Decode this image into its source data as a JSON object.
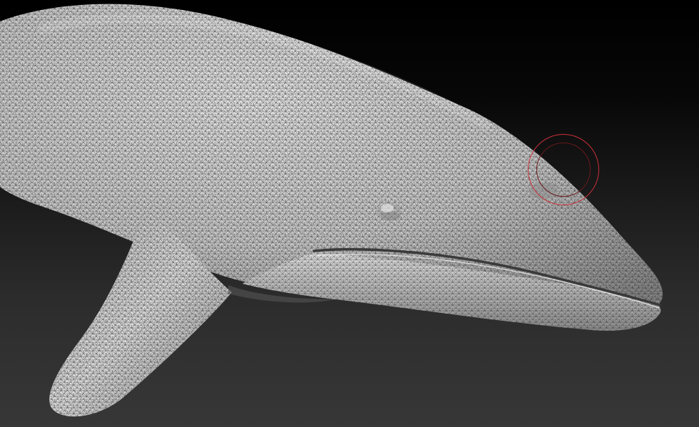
{
  "viewport": {
    "background_top": "#000000",
    "background_bottom": "#373737",
    "model": "whale-sculpt-wireframe",
    "mesh_fill": "#d8d8d8",
    "wire_color": "#1a1a1a"
  },
  "brush": {
    "outer_color": "#c8303a",
    "inner_color": "#6a1a1e"
  }
}
